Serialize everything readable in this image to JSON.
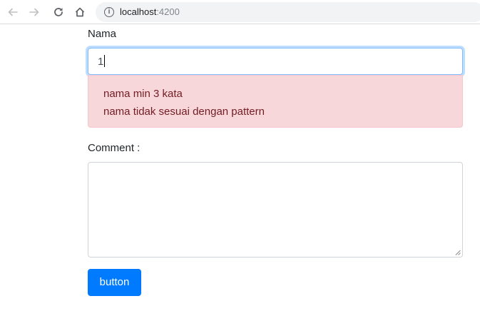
{
  "browser": {
    "url_host": "localhost",
    "url_port": ":4200",
    "info_glyph": "i"
  },
  "form": {
    "nama": {
      "label": "Nama",
      "value": "1"
    },
    "errors": [
      "nama min 3 kata",
      "nama tidak sesuai dengan pattern"
    ],
    "comment": {
      "label": "Comment :",
      "value": ""
    },
    "submit_label": "button"
  },
  "colors": {
    "primary": "#007bff",
    "danger_bg": "#f8d7da",
    "danger_text": "#721c24",
    "focus_border": "#80bdff"
  },
  "icons": [
    "back-arrow-icon",
    "forward-arrow-icon",
    "reload-icon",
    "home-icon",
    "info-icon"
  ]
}
